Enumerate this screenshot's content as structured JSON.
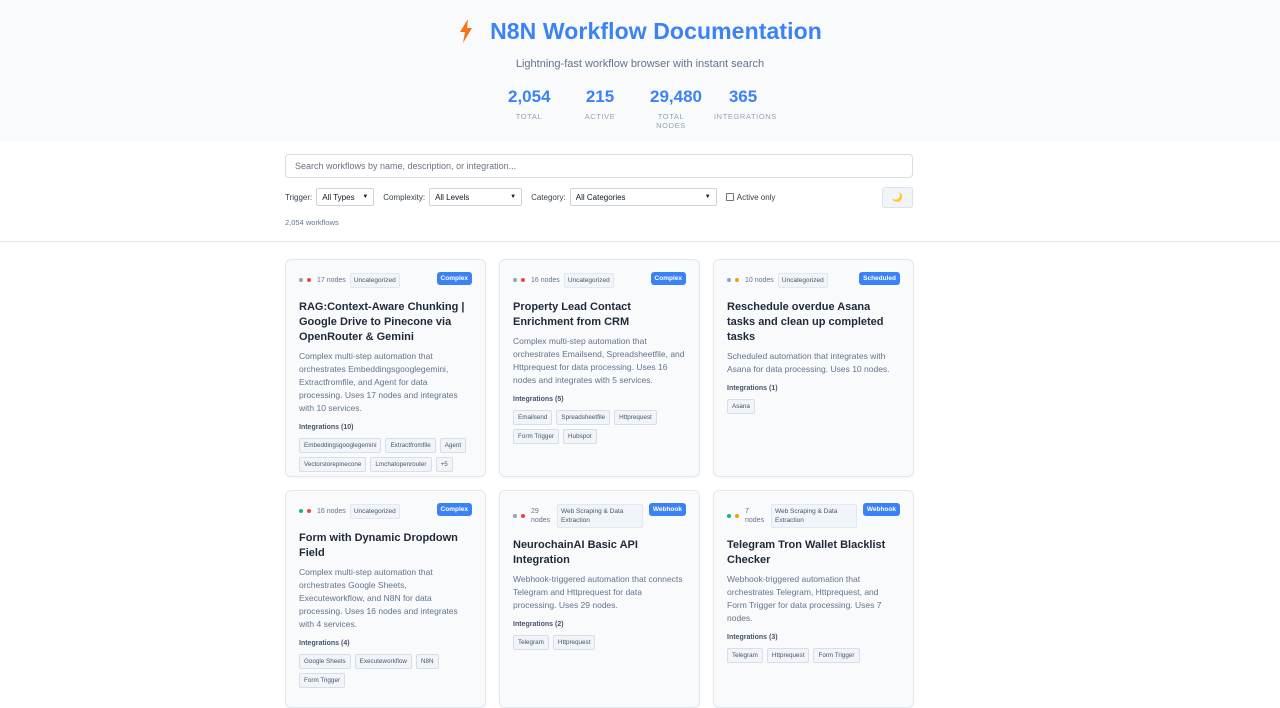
{
  "header": {
    "title": "N8N Workflow Documentation",
    "subtitle": "Lightning-fast workflow browser with instant search",
    "stats": [
      {
        "value": "2,054",
        "label": "TOTAL"
      },
      {
        "value": "215",
        "label": "ACTIVE"
      },
      {
        "value": "29,480",
        "label": "TOTAL NODES"
      },
      {
        "value": "365",
        "label": "INTEGRATIONS"
      }
    ],
    "accent": "#3b82f6",
    "icon": "lightning-bolt-icon"
  },
  "controls": {
    "search_placeholder": "Search workflows by name, description, or integration...",
    "trigger_label": "Trigger:",
    "trigger_value": "All Types",
    "complexity_label": "Complexity:",
    "complexity_value": "All Levels",
    "category_label": "Category:",
    "category_value": "All Categories",
    "active_only_label": "Active only",
    "theme_icon": "🌙",
    "count_text": "2,054 workflows"
  },
  "cards": [
    {
      "nodes": "17 nodes",
      "category": "Uncategorized",
      "badge": "Complex",
      "title": "RAG:Context-Aware Chunking | Google Drive to Pinecone via OpenRouter & Gemini",
      "desc": "Complex multi-step automation that orchestrates Embeddingsgooglegemini, Extractfromfile, and Agent for data processing. Uses 17 nodes and integrates with 10 services.",
      "integrations_label": "Integrations (10)",
      "tags": [
        "Embeddingsgooglegemini",
        "Extractfromfile",
        "Agent",
        "Vectorstorepinecone",
        "Lmchatopenrouter",
        "+5"
      ]
    },
    {
      "nodes": "16 nodes",
      "category": "Uncategorized",
      "badge": "Complex",
      "title": "Property Lead Contact Enrichment from CRM",
      "desc": "Complex multi-step automation that orchestrates Emailsend, Spreadsheetfile, and Httprequest for data processing. Uses 16 nodes and integrates with 5 services.",
      "integrations_label": "Integrations (5)",
      "tags": [
        "Emailsend",
        "Spreadsheetfile",
        "Httprequest",
        "Form Trigger",
        "Hubspot"
      ]
    },
    {
      "nodes": "10 nodes",
      "category": "Uncategorized",
      "badge": "Scheduled",
      "title": "Reschedule overdue Asana tasks and clean up completed tasks",
      "desc": "Scheduled automation that integrates with Asana for data processing. Uses 10 nodes.",
      "integrations_label": "Integrations (1)",
      "tags": [
        "Asana"
      ]
    },
    {
      "nodes": "16 nodes",
      "category": "Uncategorized",
      "badge": "Complex",
      "title": "Form with Dynamic Dropdown Field",
      "desc": "Complex multi-step automation that orchestrates Google Sheets, Executeworkflow, and N8N for data processing. Uses 16 nodes and integrates with 4 services.",
      "integrations_label": "Integrations (4)",
      "tags": [
        "Google Sheets",
        "Executeworkflow",
        "N8N",
        "Form Trigger"
      ]
    },
    {
      "nodes": "29 nodes",
      "category": "Web Scraping & Data Extraction",
      "badge": "Webhook",
      "title": "NeurochainAI Basic API Integration",
      "desc": "Webhook-triggered automation that connects Telegram and Httprequest for data processing. Uses 29 nodes.",
      "integrations_label": "Integrations (2)",
      "tags": [
        "Telegram",
        "Httprequest"
      ]
    },
    {
      "nodes": "7 nodes",
      "category": "Web Scraping & Data Extraction",
      "badge": "Webhook",
      "title": "Telegram Tron Wallet Blacklist Checker",
      "desc": "Webhook-triggered automation that orchestrates Telegram, Httprequest, and Form Trigger for data processing. Uses 7 nodes.",
      "integrations_label": "Integrations (3)",
      "tags": [
        "Telegram",
        "Httprequest",
        "Form Trigger"
      ]
    }
  ],
  "status_colors": {
    "inactive": "#94a3b8",
    "active": "#10b981",
    "complex": "#ef4444",
    "medium": "#f59e0b"
  }
}
